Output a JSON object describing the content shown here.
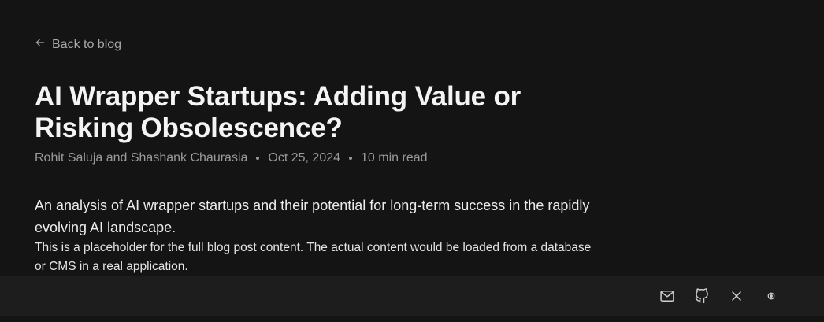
{
  "nav": {
    "back_label": "Back to blog"
  },
  "post": {
    "title": "AI Wrapper Startups: Adding Value or Risking Obsolescence?",
    "authors": "Rohit Saluja and Shashank Chaurasia",
    "date": "Oct 25, 2024",
    "read_time": "10 min read",
    "summary": "An analysis of AI wrapper startups and their potential for long-term success in the rapidly evolving AI landscape.",
    "body": "This is a placeholder for the full blog post content. The actual content would be loaded from a database or CMS in a real application."
  },
  "footer": {
    "icons": [
      "mail-icon",
      "github-icon",
      "x-icon",
      "theme-toggle-icon"
    ]
  },
  "colors": {
    "background": "#141414",
    "footer_background": "#1d1d1d",
    "muted_text": "#9a9a9a",
    "title_text": "#f4f4f4"
  }
}
